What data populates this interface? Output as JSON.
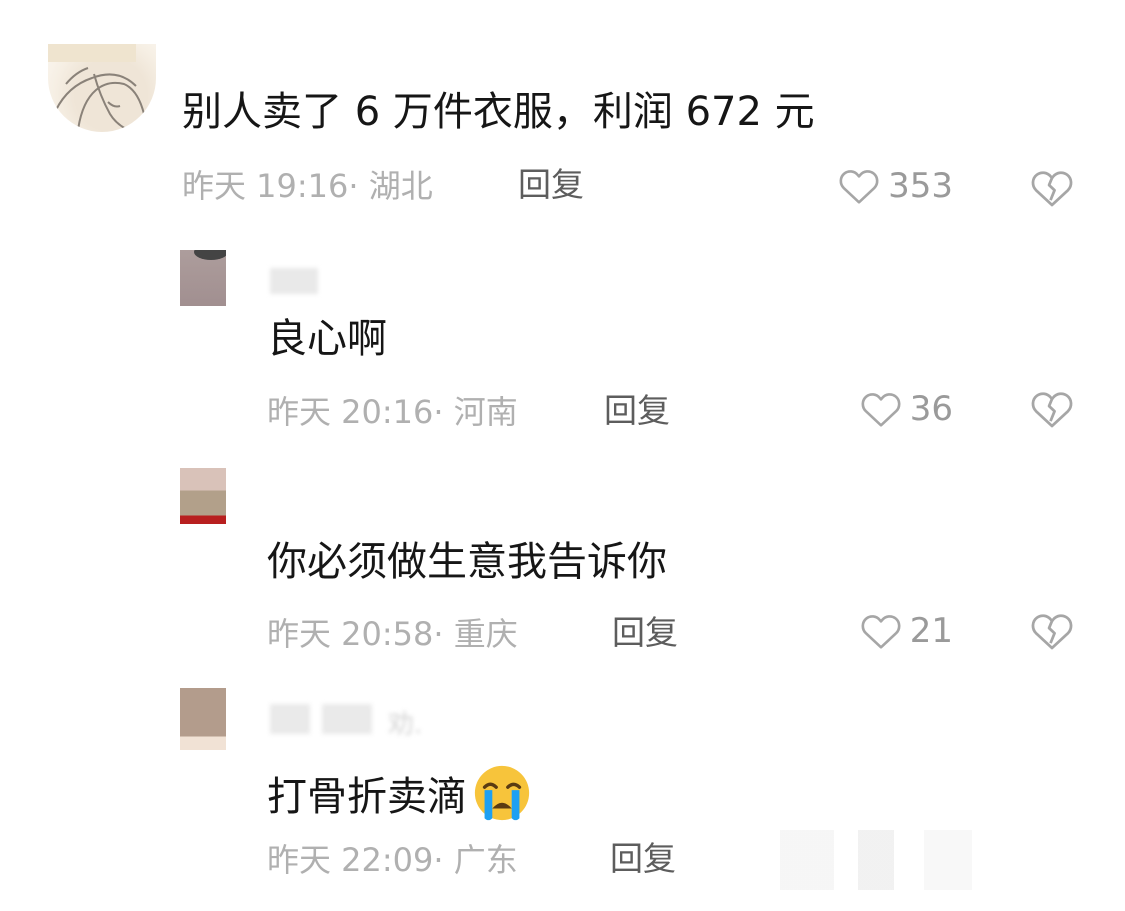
{
  "comments": [
    {
      "text": "别人卖了 6 万件衣服，利润 672 元",
      "time": "昨天 19:16",
      "location": "· 湖北",
      "reply_label": "回复",
      "likes": "353"
    },
    {
      "text": "良心啊",
      "time": "昨天 20:16",
      "location": "· 河南",
      "reply_label": "回复",
      "likes": "36"
    },
    {
      "text": "你必须做生意我告诉你",
      "time": "昨天 20:58",
      "location": "· 重庆",
      "reply_label": "回复",
      "likes": "21"
    },
    {
      "text": "打骨折卖滴",
      "time": "昨天 22:09",
      "location": "· 广东",
      "reply_label": "回复",
      "name_fragment": "劝."
    }
  ],
  "icons": {
    "like": "heart-outline-icon",
    "dislike": "broken-heart-icon",
    "emoji": "crying-face-emoji-icon"
  },
  "colors": {
    "text_primary": "#161616",
    "meta_gray": "#b0b0b0",
    "reply_gray": "#5d5d5d",
    "like_gray": "#9a9a9a",
    "icon_gray": "#a6a6a6",
    "emoji_yellow": "#f7c43b",
    "emoji_blue": "#1ea0f2"
  }
}
